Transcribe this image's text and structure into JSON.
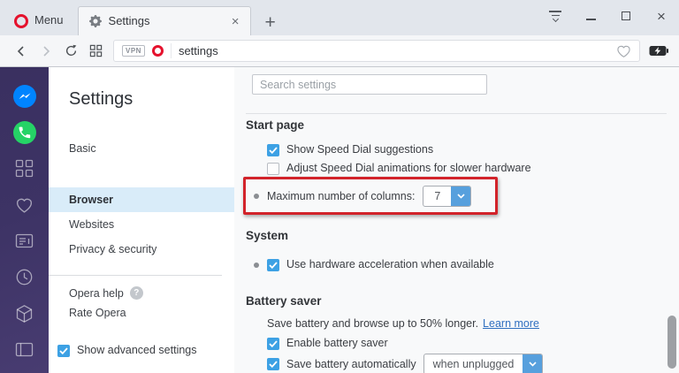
{
  "titlebar": {
    "menu_label": "Menu",
    "tab_title": "Settings",
    "icons": {
      "tab_close": "×",
      "new_tab": "+",
      "win_close": "×",
      "help": "?"
    }
  },
  "toolbar": {
    "vpn_badge": "VPN",
    "url": "settings"
  },
  "rail_icons": [
    "messenger",
    "whatsapp",
    "speed-dial",
    "bookmarks",
    "personal-news",
    "history",
    "extensions",
    "panels"
  ],
  "settings_nav": {
    "title": "Settings",
    "items": [
      {
        "label": "Basic",
        "selected": false
      },
      {
        "label": "Browser",
        "selected": true
      },
      {
        "label": "Websites",
        "selected": false
      },
      {
        "label": "Privacy & security",
        "selected": false
      }
    ],
    "help_label": "Opera help",
    "rate_label": "Rate Opera",
    "advanced_checkbox": {
      "label": "Show advanced settings",
      "checked": true
    }
  },
  "content": {
    "search_placeholder": "Search settings",
    "start_page": {
      "title": "Start page",
      "show_suggestions": {
        "label": "Show Speed Dial suggestions",
        "checked": true
      },
      "adjust_animations": {
        "label": "Adjust Speed Dial animations for slower hardware",
        "checked": false
      },
      "max_columns": {
        "label": "Maximum number of columns:",
        "value": "7",
        "highlighted": true
      }
    },
    "system": {
      "title": "System",
      "hardware_acceleration": {
        "label": "Use hardware acceleration when available",
        "checked": true
      }
    },
    "battery_saver": {
      "title": "Battery saver",
      "description": "Save battery and browse up to 50% longer.",
      "learn_more": "Learn more",
      "enable": {
        "label": "Enable battery saver",
        "checked": true
      },
      "auto": {
        "label": "Save battery automatically",
        "checked": true,
        "value": "when unplugged"
      }
    }
  },
  "colors": {
    "checkbox_blue": "#3da1e4",
    "select_button_blue": "#57a0dd",
    "highlight_red": "#d2232a",
    "nav_selected_bg": "#d9ecf9",
    "link_blue": "#2f6fc0",
    "rail_gradient_top": "#3a3060",
    "rail_gradient_bottom": "#483c71",
    "opera_red": "#e5122d"
  }
}
